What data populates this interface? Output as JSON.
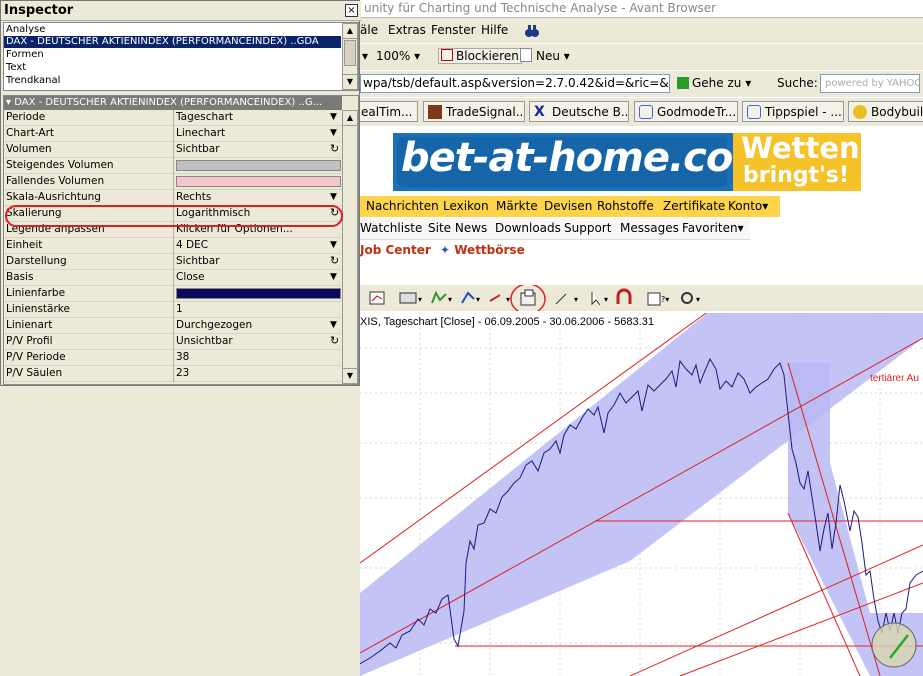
{
  "browser": {
    "title": "unity für Charting und Technische Analyse - Avant Browser",
    "menu": [
      "äle",
      "Extras",
      "Fenster",
      "Hilfe"
    ],
    "zoom": "100%",
    "block_label": "Blockieren",
    "new_label": "Neu",
    "address": "wpa/tsb/default.asp&version=2.7.0.42&id=&ric=&fid",
    "go_label": "Gehe zu",
    "search_label": "Suche:",
    "search_placeholder": "powered by YAHOO!",
    "tabs": [
      "ealTim...",
      "TradeSignal...",
      "Deutsche B...",
      "GodmodeTr...",
      "Tippspiel - ...",
      "Bodybuildi..."
    ]
  },
  "banner": {
    "brand": "bet-at-home.com",
    "slogan_1": "Wetten",
    "slogan_2": "bringt's!"
  },
  "nav1": [
    "Nachrichten",
    "Lexikon",
    "Märkte",
    "Devisen",
    "Rohstoffe",
    "Zertifikate",
    "Konto"
  ],
  "nav2": [
    "Watchliste",
    "Site News",
    "Downloads",
    "Support",
    "Messages",
    "Favoriten"
  ],
  "subnav": {
    "left": "Job Center",
    "right": "Wettbörse"
  },
  "chart": {
    "caption": "XIS, Tageschart [Close] - 06.09.2005 - 30.06.2006 - 5683.31",
    "annotation": "tertiärer Au"
  },
  "inspector": {
    "title": "Inspector",
    "close": "×",
    "list": [
      "Analyse",
      "DAX - DEUTSCHER AKTIENINDEX (PERFORMANCEINDEX) ..GDA",
      "Formen",
      "Text",
      "Trendkanal"
    ],
    "props_header": "DAX - DEUTSCHER AKTIENINDEX (PERFORMANCEINDEX) ..G...",
    "props": [
      {
        "name": "Periode",
        "value": "Tageschart",
        "ctrl": "dropdown"
      },
      {
        "name": "Chart-Art",
        "value": "Linechart",
        "ctrl": "dropdown"
      },
      {
        "name": "Volumen",
        "value": "Sichtbar",
        "ctrl": "cycle"
      },
      {
        "name": "Steigendes Volumen",
        "value": "",
        "ctrl": "swatch",
        "color": "#c0c0c0"
      },
      {
        "name": "Fallendes Volumen",
        "value": "",
        "ctrl": "swatch",
        "color": "#f4c6cc"
      },
      {
        "name": "Skala-Ausrichtung",
        "value": "Rechts",
        "ctrl": "dropdown"
      },
      {
        "name": "Skalierung",
        "value": "Logarithmisch",
        "ctrl": "cycle"
      },
      {
        "name": "Legende anpassen",
        "value": "Klicken für Optionen...",
        "ctrl": "none"
      },
      {
        "name": "Einheit",
        "value": "4 DEC",
        "ctrl": "dropdown"
      },
      {
        "name": "Darstellung",
        "value": "Sichtbar",
        "ctrl": "cycle"
      },
      {
        "name": "Basis",
        "value": "Close",
        "ctrl": "dropdown"
      },
      {
        "name": "Linienfarbe",
        "value": "",
        "ctrl": "swatch",
        "color": "#0a0a5c"
      },
      {
        "name": "Linienstärke",
        "value": "1",
        "ctrl": "none"
      },
      {
        "name": "Linienart",
        "value": "Durchgezogen",
        "ctrl": "dropdown"
      },
      {
        "name": "P/V Profil",
        "value": "Unsichtbar",
        "ctrl": "cycle"
      },
      {
        "name": "P/V Periode",
        "value": "38",
        "ctrl": "none"
      },
      {
        "name": "P/V Säulen",
        "value": "23",
        "ctrl": "none"
      }
    ]
  },
  "colors": {
    "highlight": "#e02020",
    "channel_fill": "#b8b8f5",
    "price_line": "#1a1a80",
    "nav_yellow": "#ffd34a"
  }
}
